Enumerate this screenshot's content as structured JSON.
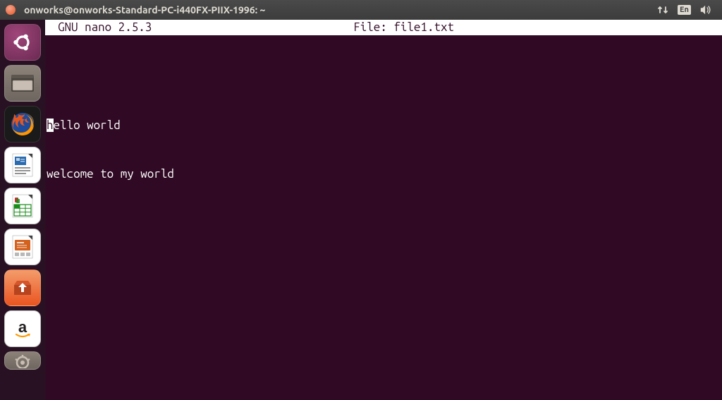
{
  "titlebar": {
    "title": "onworks@onworks-Standard-PC-i440FX-PIIX-1996: ~",
    "lang": "En"
  },
  "nano": {
    "app": "GNU nano 2.5.3",
    "file_prefix": "File: ",
    "filename": "file1.txt"
  },
  "editor": {
    "cursor_char": "h",
    "line1_rest": "ello world",
    "line2": "welcome to my world"
  },
  "launcher": {
    "items": [
      {
        "name": "dash",
        "label": "Dash"
      },
      {
        "name": "files",
        "label": "Files"
      },
      {
        "name": "firefox",
        "label": "Firefox"
      },
      {
        "name": "writer",
        "label": "LibreOffice Writer"
      },
      {
        "name": "calc",
        "label": "LibreOffice Calc"
      },
      {
        "name": "impress",
        "label": "LibreOffice Impress"
      },
      {
        "name": "software",
        "label": "Ubuntu Software"
      },
      {
        "name": "amazon",
        "label": "Amazon"
      },
      {
        "name": "settings",
        "label": "System Settings"
      }
    ]
  }
}
